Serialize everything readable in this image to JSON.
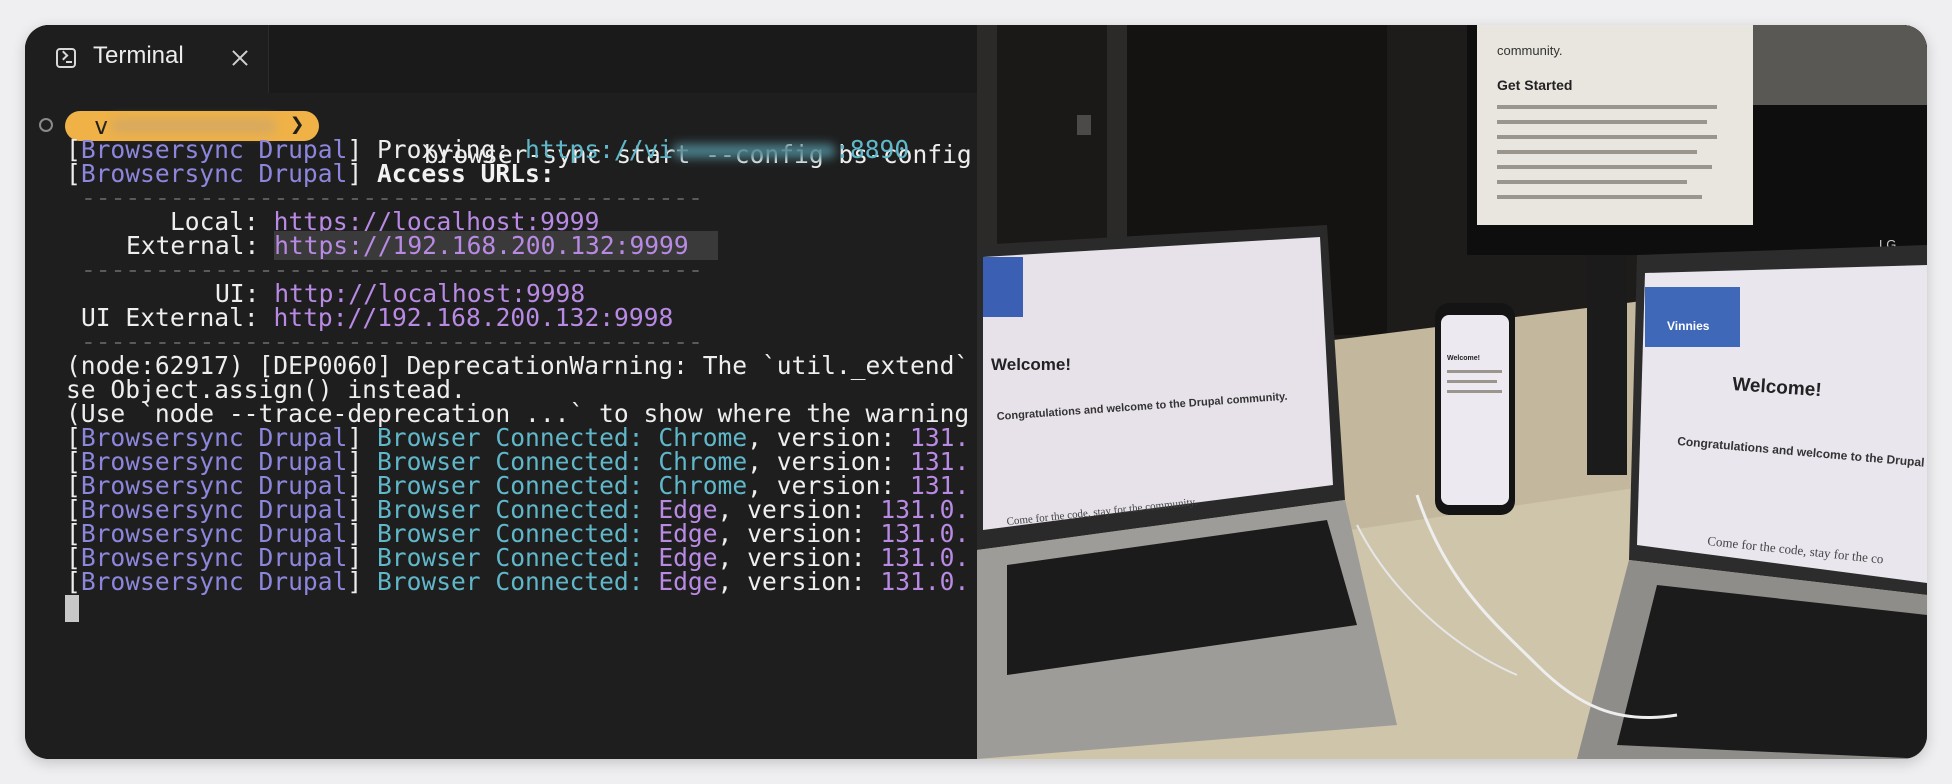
{
  "tab": {
    "title": "Terminal",
    "icon": "terminal-icon"
  },
  "prompt": {
    "user_visible": "v",
    "command": "browser-sync start --config bs-config.js",
    "pill_color": "#f0b247"
  },
  "colors": {
    "prefix": "#8c86dd",
    "cyan": "#5fb7c9",
    "version": "#b88ae3",
    "background": "#1e1e1e"
  },
  "output": {
    "prefix": "Browsersync Drupal",
    "proxy_label": "Proxying:",
    "proxy_url_start": "https://vi",
    "proxy_url_end": ":8890",
    "access_label": "Access URLs:",
    "rule": "------------------------------------------",
    "local_label": "Local:",
    "local_url": "https://localhost:9999",
    "external_label": "External:",
    "external_url": "https://192.168.200.132:9999",
    "ui_label": "UI:",
    "ui_url": "http://localhost:9998",
    "ui_external_label": "UI External:",
    "ui_external_url": "http://192.168.200.132:9998",
    "warning_1": "(node:62917) [DEP0060] DeprecationWarning: The `util._extend`",
    "warning_2": "se Object.assign() instead.",
    "warning_3": "(Use `node --trace-deprecation ...` to show where the warning",
    "connected_label": "Browser Connected:",
    "version_label": ", version: ",
    "connections": [
      {
        "browser": "Chrome",
        "version": "131."
      },
      {
        "browser": "Chrome",
        "version": "131."
      },
      {
        "browser": "Chrome",
        "version": "131."
      },
      {
        "browser": "Edge",
        "version": "131.0."
      },
      {
        "browser": "Edge",
        "version": "131.0."
      },
      {
        "browser": "Edge",
        "version": "131.0."
      },
      {
        "browser": "Edge",
        "version": "131.0."
      }
    ]
  },
  "photo": {
    "monitor_heading": "Get Started",
    "monitor_text_top": "community.",
    "laptop_left_heading": "Welcome!",
    "laptop_left_subheading": "Congratulations and welcome to the Drupal community.",
    "laptop_left_tagline": "Come for the code, stay for the community.",
    "phone_heading": "Welcome!",
    "laptop_right_brand": "Vinnies",
    "laptop_right_heading": "Welcome!",
    "laptop_right_subheading": "Congratulations and welcome to the Drupal community.",
    "laptop_right_tagline": "Come for the code, stay for the co",
    "monitor_brand": "LG"
  }
}
